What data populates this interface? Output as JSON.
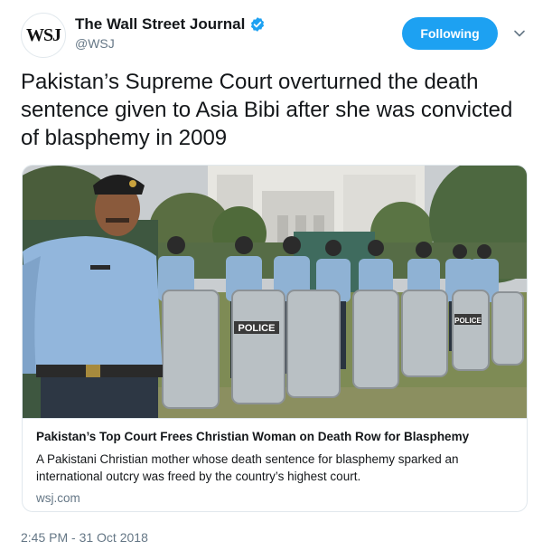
{
  "account": {
    "avatar_text": "WSJ",
    "display_name": "The Wall Street Journal",
    "handle": "@WSJ",
    "verified": true
  },
  "follow_button": {
    "label": "Following"
  },
  "tweet": {
    "text": "Pakistan’s Supreme Court overturned the death sentence given to Asia Bibi after she was convicted of blasphemy in 2009",
    "timestamp": "2:45 PM - 31 Oct 2018"
  },
  "card": {
    "shield_label_1": "POLICE",
    "shield_label_2": "POLICE",
    "title": "Pakistan’s Top Court Frees Christian Woman on Death Row for Blasphemy",
    "description": "A Pakistani Christian mother whose death sentence for blasphemy sparked an international outcry was freed by the country’s highest court.",
    "domain": "wsj.com"
  },
  "colors": {
    "accent": "#1da1f2",
    "text": "#14171a",
    "secondary": "#657786",
    "border": "#e1e8ed"
  },
  "icons": {
    "verified": "verified-badge-icon",
    "caret": "chevron-down-icon"
  }
}
